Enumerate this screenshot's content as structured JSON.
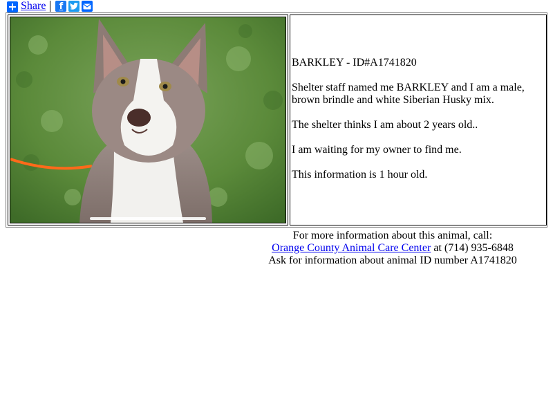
{
  "share": {
    "label": "Share",
    "icons": [
      "plus-icon",
      "facebook-icon",
      "twitter-icon",
      "email-icon"
    ],
    "colors": {
      "plus": "#0166ff",
      "facebook": "#1877f2",
      "twitter": "#1d9bf0",
      "email": "#0166ff"
    }
  },
  "photo": {
    "alt": "Brown brindle and white Siberian Husky mix dog sitting on grass"
  },
  "animal": {
    "title": "BARKLEY - ID#A1741820",
    "description": "Shelter staff named me BARKLEY and I am a male, brown brindle and white Siberian Husky mix.",
    "age": "The shelter thinks I am about 2 years old..",
    "status": "I am waiting for my owner to find me.",
    "freshness": "This information is 1 hour old."
  },
  "footer": {
    "line1": "For more information about this animal, call:",
    "center_link": "Orange County Animal Care Center",
    "phone": " at (714) 935-6848",
    "line3": "Ask for information about animal ID number A1741820"
  },
  "colors": {
    "link": "#0000ee",
    "grass": "#5b8a3a",
    "leash": "#ff6a1a"
  }
}
